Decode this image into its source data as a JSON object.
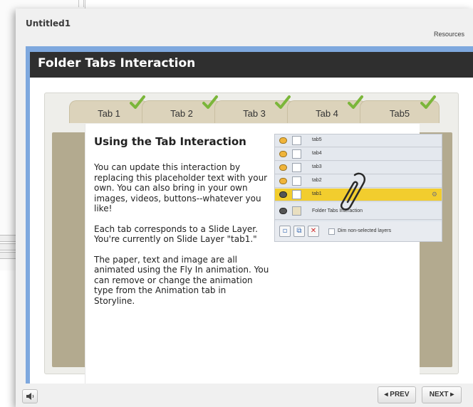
{
  "window": {
    "title": "Untitled1",
    "resources_label": "Resources"
  },
  "slide": {
    "title": "Folder Tabs Interaction",
    "tabs": [
      {
        "label": "Tab 1",
        "completed": true
      },
      {
        "label": "Tab 2",
        "completed": true
      },
      {
        "label": "Tab 3",
        "completed": true
      },
      {
        "label": "Tab 4",
        "completed": true
      },
      {
        "label": "Tab5",
        "completed": true
      }
    ],
    "content_title": "Using the Tab Interaction",
    "paragraphs": [
      "You can update this interaction by replacing this placeholder text with your own. You can also bring in your own images, videos, buttons--whatever you like!",
      "Each tab corresponds to a Slide Layer. You're currently on Slide Layer \"tab1.\"",
      "The paper, text and image are all animated using the Fly In animation. You can remove or change the animation type from the Animation tab in Storyline."
    ]
  },
  "layers_panel": {
    "layers": [
      "tab5",
      "tab4",
      "tab3",
      "tab2",
      "tab1"
    ],
    "selected_layer": "tab1",
    "base_layer": "Folder Tabs Interaction",
    "dim_label": "Dim non-selected layers"
  },
  "controls": {
    "prev_label": "◂ PREV",
    "next_label": "NEXT ▸",
    "volume_icon": "speaker-icon"
  },
  "colors": {
    "stage_blue": "#7ea8de",
    "header_dark": "#2f2f2f",
    "tab_tan": "#dcd3bb",
    "folder_back": "#b3aa8f",
    "selected_layer": "#f2cd2e",
    "check_green": "#7bb63a"
  }
}
